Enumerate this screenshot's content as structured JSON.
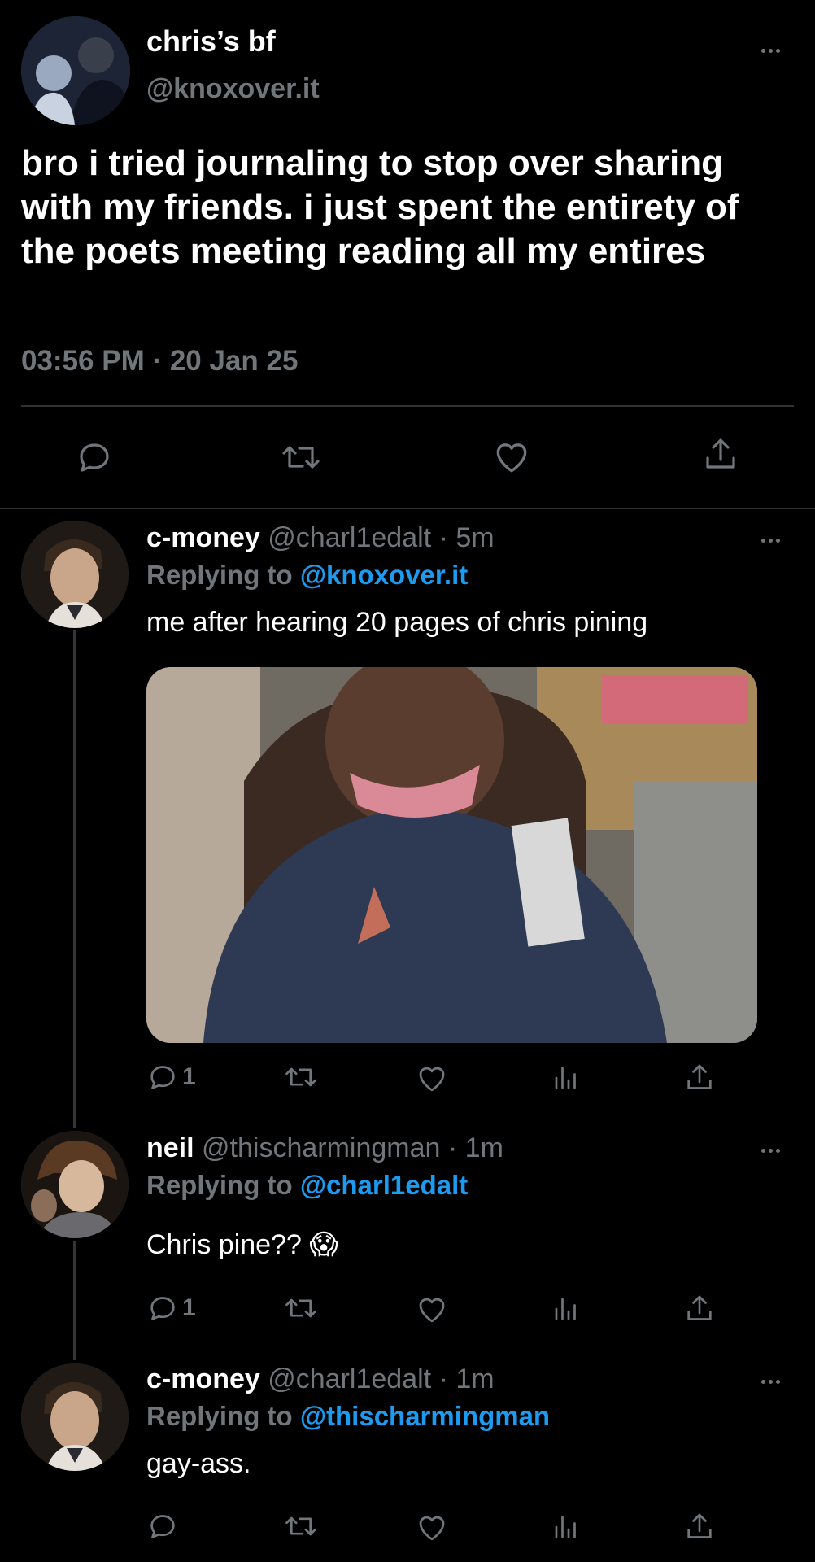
{
  "main_tweet": {
    "display_name": "chris’s bf",
    "handle": "@knoxover.it",
    "text": "bro i tried journaling to stop over sharing with my friends. i just spent the entirety of the poets meeting reading all my entires",
    "timestamp": "03:56 PM · 20 Jan 25",
    "actions": [
      "reply-icon",
      "retweet-icon",
      "like-icon",
      "share-icon"
    ]
  },
  "replies": [
    {
      "display_name": "c-money",
      "handle": "@charl1edalt",
      "time": "· 5m",
      "replying_label": "Replying to ",
      "replying_to": "@knoxover.it",
      "text": "me after hearing 20 pages of chris pining",
      "has_media": true,
      "reply_count": "1"
    },
    {
      "display_name": "neil",
      "handle": "@thischarmingman",
      "time": "· 1m",
      "replying_label": "Replying to ",
      "replying_to": "@charl1edalt",
      "text": "Chris pine?? 😱",
      "has_media": false,
      "reply_count": "1"
    },
    {
      "display_name": "c-money",
      "handle": "@charl1edalt",
      "time": "· 1m",
      "replying_label": "Replying to ",
      "replying_to": "@thischarmingman",
      "text": "gay-ass.",
      "has_media": false,
      "reply_count": ""
    }
  ],
  "colors": {
    "background": "#000000",
    "secondary_text": "#71767b",
    "link": "#1d9bf0",
    "divider": "#2f3336"
  }
}
